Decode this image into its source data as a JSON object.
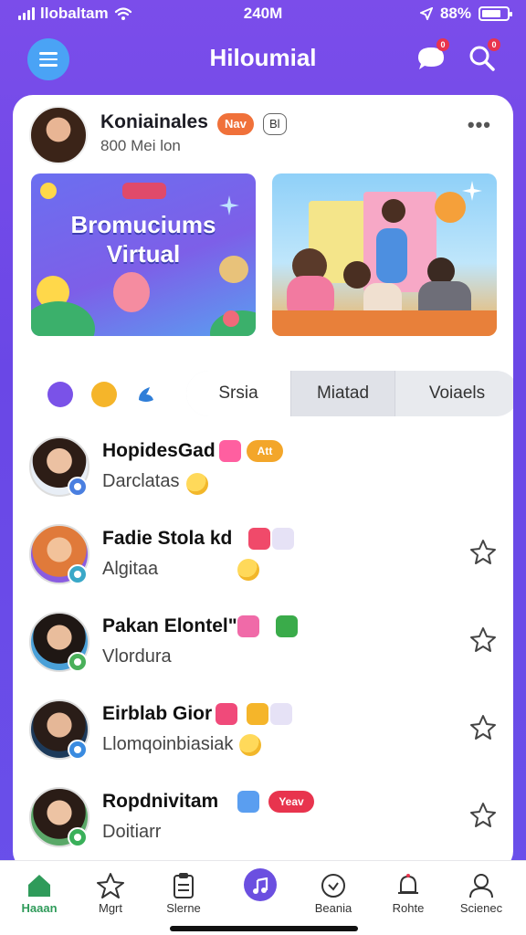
{
  "status_bar": {
    "carrier": "llobaltam",
    "time": "240M",
    "battery": "88%"
  },
  "header": {
    "title": "Hiloumial",
    "menu_icon": "hamburger-icon",
    "chat_icon": "chat-bubble-icon",
    "search_icon": "search-icon",
    "chat_badge": "0",
    "search_badge": "0"
  },
  "profile": {
    "name": "Koniainales",
    "tag_primary": "Nav",
    "tag_secondary": "Bl",
    "subtitle": "800 Mei lon",
    "more_icon": "more-dots-icon"
  },
  "banners": [
    {
      "title": "Bromuciums Virtual"
    },
    {
      "title": ""
    }
  ],
  "filters": {
    "icons": [
      "chat-filter-icon",
      "coin-filter-icon",
      "leaf-filter-icon"
    ],
    "segments": [
      "Srsia",
      "Miatad",
      "Voiaels"
    ]
  },
  "list": [
    {
      "name": "HopidesGad",
      "badge": "Att",
      "subtitle": "Darclatas",
      "action_icon": ""
    },
    {
      "name": "Fadie Stola  kd",
      "badge": "",
      "subtitle": "Algitaa",
      "action_icon": "star-outline-icon"
    },
    {
      "name": "Pakan Elontel\"",
      "badge": "",
      "subtitle": "Vlordura",
      "action_icon": "star-outline-icon"
    },
    {
      "name": "Eirblab Gior",
      "badge": "",
      "subtitle": "Llomqoinbiasiak",
      "action_icon": "star-outline-icon"
    },
    {
      "name": "Ropdnivitam",
      "badge": "Yeav",
      "subtitle": "Doitiarr",
      "action_icon": "star-outline-icon"
    }
  ],
  "bottom_nav": [
    {
      "label": "Haaan",
      "icon": "home-icon",
      "active": true
    },
    {
      "label": "Mgrt",
      "icon": "star-icon",
      "active": false
    },
    {
      "label": "Slerne",
      "icon": "clipboard-icon",
      "active": false
    },
    {
      "label": "",
      "icon": "music-icon",
      "active": false
    },
    {
      "label": "Beania",
      "icon": "clock-icon",
      "active": false
    },
    {
      "label": "Rohte",
      "icon": "bell-icon",
      "active": false
    },
    {
      "label": "Scienec",
      "icon": "profile-icon",
      "active": false
    }
  ],
  "colors": {
    "background": "#6a47e6",
    "accent_orange": "#f0713a",
    "accent_pink": "#e8344e",
    "nav_active": "#2f9b5a",
    "music_fab": "#6b4fe0"
  }
}
